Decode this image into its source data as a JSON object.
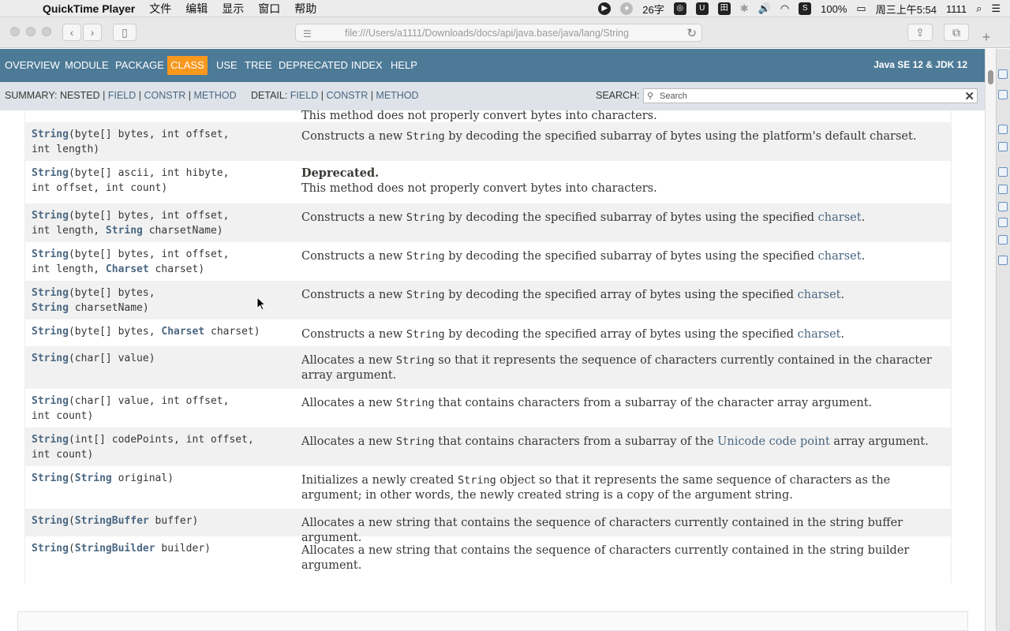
{
  "menubar": {
    "app_name": "QuickTime Player",
    "menus": [
      "文件",
      "编辑",
      "显示",
      "窗口",
      "帮助"
    ],
    "status": {
      "word_count": "26字",
      "battery": "100%",
      "datetime": "周三上午5:54",
      "user": "1111"
    }
  },
  "browser": {
    "url": "file:///Users/a1111/Downloads/docs/api/java.base/java/lang/String"
  },
  "nav": {
    "items": [
      "OVERVIEW",
      "MODULE",
      "PACKAGE",
      "CLASS",
      "USE",
      "TREE",
      "DEPRECATED",
      "INDEX",
      "HELP"
    ],
    "active": "CLASS",
    "about": "Java SE 12 & JDK 12"
  },
  "subnav": {
    "summary_label": "SUMMARY:",
    "summary_nested": "NESTED",
    "summary_field": "FIELD",
    "summary_constr": "CONSTR",
    "summary_method": "METHOD",
    "detail_label": "DETAIL:",
    "detail_field": "FIELD",
    "detail_constr": "CONSTR",
    "detail_method": "METHOD",
    "search_label": "SEARCH:",
    "search_placeholder": "Search"
  },
  "constructors": [
    {
      "sig1": "",
      "sig2": "",
      "desc": "This method does not properly convert bytes into characters."
    },
    {
      "sig1": "String(byte[] bytes, int offset,",
      "sig2": "int length)",
      "desc": "Constructs a new String by decoding the specified subarray of bytes using the platform's default charset."
    },
    {
      "sig1": "String(byte[] ascii, int hibyte,",
      "sig2": "int offset, int count)",
      "deprecated": "Deprecated.",
      "desc": "This method does not properly convert bytes into characters."
    },
    {
      "sig1": "String(byte[] bytes, int offset,",
      "sig2": "int length, String charsetName)",
      "desc": "Constructs a new String by decoding the specified subarray of bytes using the specified charset."
    },
    {
      "sig1": "String(byte[] bytes, int offset,",
      "sig2": "int length, Charset charset)",
      "desc": "Constructs a new String by decoding the specified subarray of bytes using the specified charset."
    },
    {
      "sig1": "String(byte[] bytes,",
      "sig2": "String charsetName)",
      "desc": "Constructs a new String by decoding the specified array of bytes using the specified charset."
    },
    {
      "sig1": "String(byte[] bytes, Charset charset)",
      "sig2": "",
      "desc": "Constructs a new String by decoding the specified array of bytes using the specified charset."
    },
    {
      "sig1": "String(char[] value)",
      "sig2": "",
      "desc": "Allocates a new String so that it represents the sequence of characters currently contained in the character array argument."
    },
    {
      "sig1": "String(char[] value, int offset,",
      "sig2": "int count)",
      "desc": "Allocates a new String that contains characters from a subarray of the character array argument."
    },
    {
      "sig1": "String(int[] codePoints, int offset,",
      "sig2": "int count)",
      "desc": "Allocates a new String that contains characters from a subarray of the Unicode code point array argument."
    },
    {
      "sig1": "String(String original)",
      "sig2": "",
      "desc": "Initializes a newly created String object so that it represents the same sequence of characters as the argument; in other words, the newly created string is a copy of the argument string."
    },
    {
      "sig1": "String(StringBuffer buffer)",
      "sig2": "",
      "desc": "Allocates a new string that contains the sequence of characters currently contained in the string buffer argument."
    },
    {
      "sig1": "String(StringBuilder builder)",
      "sig2": "",
      "desc": "Allocates a new string that contains the sequence of characters currently contained in the string builder argument."
    }
  ],
  "colors": {
    "nav_bg": "#4d7a97",
    "nav_active": "#f8981d",
    "link": "#4a6782",
    "subnav_bg": "#dee3e9",
    "row_alt": "#f1f1f1"
  }
}
